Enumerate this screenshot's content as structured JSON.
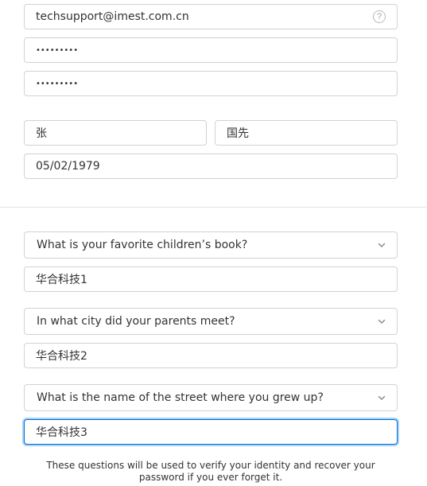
{
  "account": {
    "email_value": "techsupport@imest.com.cn",
    "password_value": "•••••••••",
    "confirm_password_value": "•••••••••"
  },
  "name": {
    "first_name_value": "张",
    "last_name_value": "国先"
  },
  "birthday": {
    "value": "05/02/1979"
  },
  "security": {
    "questions": [
      {
        "question": "What is your favorite children’s book?",
        "answer": "华合科技1"
      },
      {
        "question": "In what city did your parents meet?",
        "answer": "华合科技2"
      },
      {
        "question": "What is the name of the street where you grew up?",
        "answer": "华合科技3"
      }
    ],
    "note": "These questions will be used to verify your identity and recover your password if you ever forget it."
  },
  "icons": {
    "help": "?"
  },
  "colors": {
    "border": "#d2d2d7",
    "focus": "#0070c9",
    "text": "#333333"
  }
}
